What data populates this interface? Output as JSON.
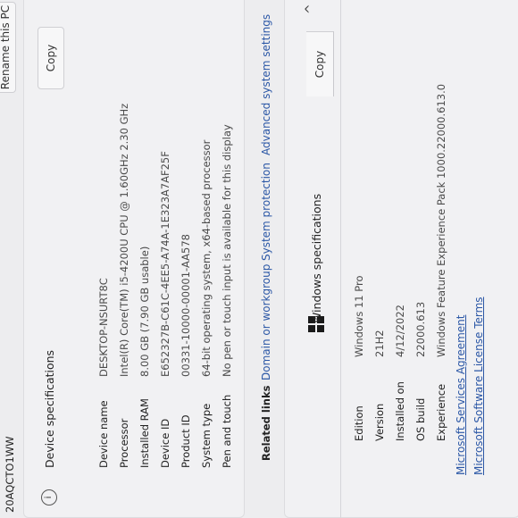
{
  "top": {
    "pc_model": "20AQCTO1WW",
    "rename_label": "Rename this PC"
  },
  "device_specs": {
    "title": "Device specifications",
    "copy_label": "Copy",
    "rows": [
      {
        "label": "Device name",
        "value": "DESKTOP-NSURT8C"
      },
      {
        "label": "Processor",
        "value": "Intel(R) Core(TM) i5-4200U CPU @ 1.60GHz   2.30 GHz"
      },
      {
        "label": "Installed RAM",
        "value": "8.00 GB (7.90 GB usable)"
      },
      {
        "label": "Device ID",
        "value": "E652327B-C61C-4EE5-A74A-1E323A7AF25F"
      },
      {
        "label": "Product ID",
        "value": "00331-10000-00001-AA578"
      },
      {
        "label": "System type",
        "value": "64-bit operating system, x64-based processor"
      },
      {
        "label": "Pen and touch",
        "value": "No pen or touch input is available for this display"
      }
    ]
  },
  "related_links": {
    "label": "Related links",
    "links": [
      "Domain or workgroup",
      "System protection",
      "Advanced system settings"
    ]
  },
  "windows_specs": {
    "title": "Windows specifications",
    "copy_label": "Copy",
    "rows": [
      {
        "label": "Edition",
        "value": "Windows 11 Pro"
      },
      {
        "label": "Version",
        "value": "21H2"
      },
      {
        "label": "Installed on",
        "value": "4/12/2022"
      },
      {
        "label": "OS build",
        "value": "22000.613"
      },
      {
        "label": "Experience",
        "value": "Windows Feature Experience Pack 1000.22000.613.0"
      }
    ],
    "links": [
      "Microsoft Services Agreement",
      "Microsoft Software License Terms"
    ]
  },
  "icons": {
    "info": "info-icon",
    "windows_logo": "windows-logo-icon",
    "chevron": "chevron-up-icon"
  }
}
